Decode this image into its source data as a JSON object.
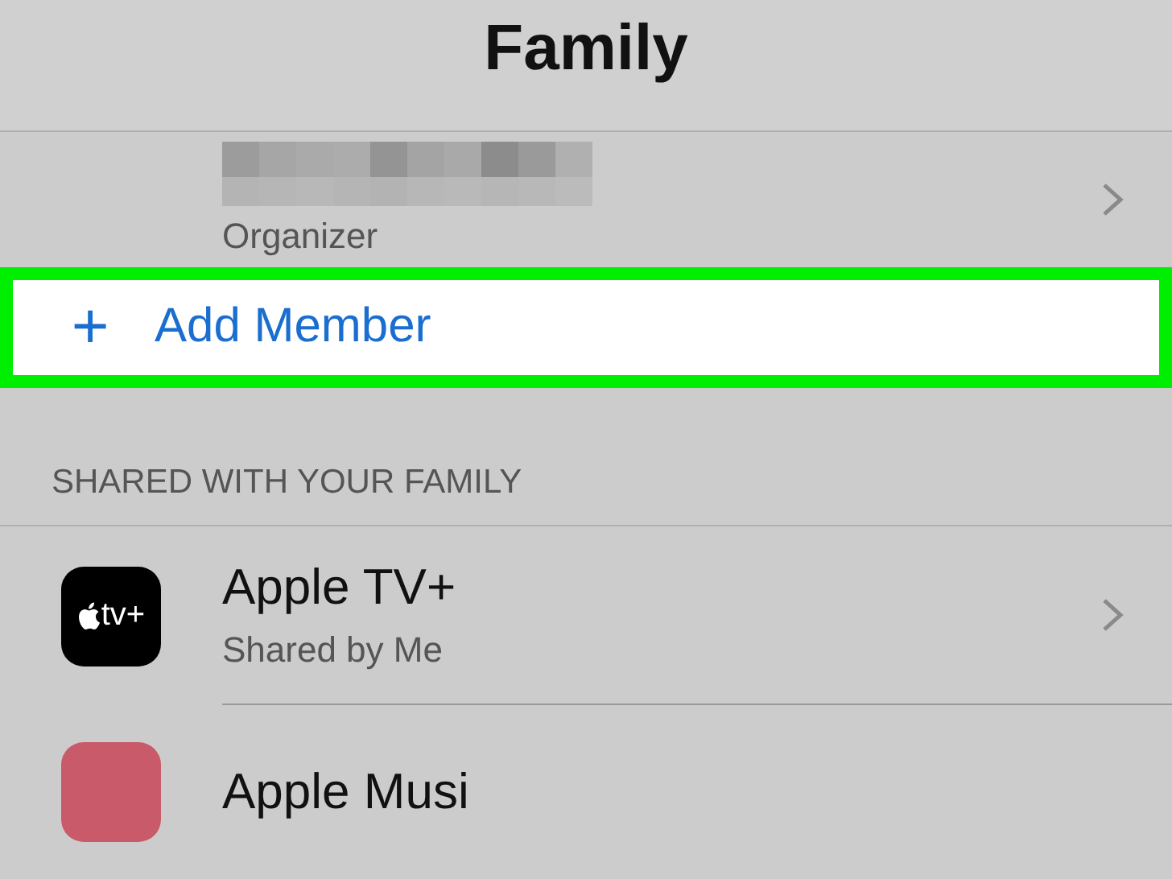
{
  "title": "Family",
  "organizer": {
    "role": "Organizer"
  },
  "add_member": {
    "icon": "+",
    "label": "Add Member",
    "highlighted": true
  },
  "section_header": "SHARED WITH YOUR FAMILY",
  "services": [
    {
      "kind": "tv",
      "icon_text": "tv+",
      "title": "Apple TV+",
      "subtitle": "Shared by Me"
    },
    {
      "kind": "music",
      "title": "Apple Musi"
    }
  ]
}
